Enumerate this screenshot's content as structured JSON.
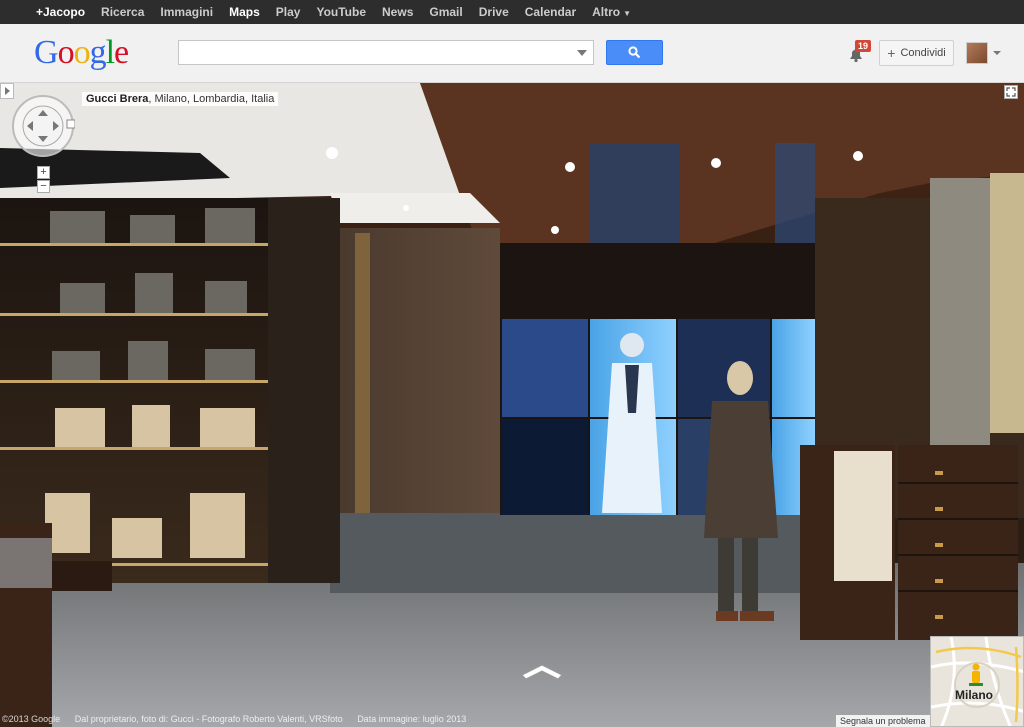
{
  "topnav": {
    "user": "+Jacopo",
    "items": [
      "Ricerca",
      "Immagini",
      "Maps",
      "Play",
      "YouTube",
      "News",
      "Gmail",
      "Drive",
      "Calendar",
      "Altro"
    ],
    "active": "Maps"
  },
  "header": {
    "logo": "Google",
    "search_value": "",
    "search_placeholder": "",
    "notification_count": "19",
    "share_label": "Condividi"
  },
  "streetview": {
    "place_name": "Gucci Brera",
    "place_rest": ", Milano, Lombardia, Italia",
    "footer": {
      "copyright": "©2013 Google",
      "attribution": "Dal proprietario, foto di: Gucci - Fotografo Roberto Valenti, VRSfoto",
      "date": "Data immagine: luglio 2013"
    },
    "report_label": "Segnala un problema",
    "minimap_label": "Milano"
  },
  "colors": {
    "topbar_bg": "#2d2d2d",
    "header_bg": "#f1f1f1",
    "search_button": "#4b8df8",
    "badge": "#d14836"
  }
}
